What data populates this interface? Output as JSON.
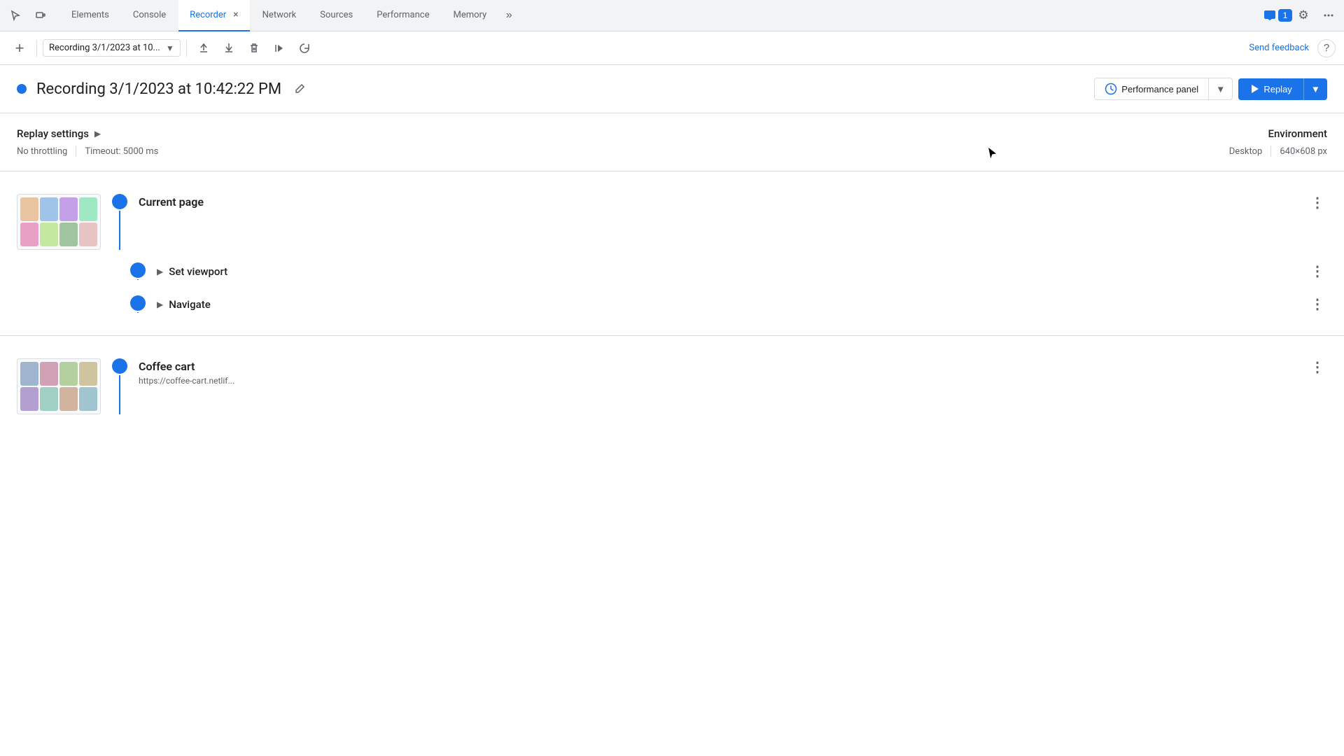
{
  "tabs": {
    "items": [
      {
        "label": "Elements",
        "active": false
      },
      {
        "label": "Console",
        "active": false
      },
      {
        "label": "Recorder",
        "active": true,
        "hasClose": true
      },
      {
        "label": "Network",
        "active": false
      },
      {
        "label": "Sources",
        "active": false
      },
      {
        "label": "Performance",
        "active": false
      },
      {
        "label": "Memory",
        "active": false
      }
    ],
    "more_label": "»",
    "badge": "1"
  },
  "toolbar": {
    "add_label": "+",
    "recording_name": "Recording 3/1/2023 at 10...",
    "send_feedback": "Send feedback",
    "help_icon": "?"
  },
  "recording": {
    "title": "Recording 3/1/2023 at 10:42:22 PM",
    "performance_panel_label": "Performance panel",
    "replay_label": "Replay"
  },
  "settings": {
    "title": "Replay settings",
    "throttling": "No throttling",
    "timeout": "Timeout: 5000 ms",
    "env_title": "Environment",
    "env_type": "Desktop",
    "env_resolution": "640×608 px"
  },
  "steps": [
    {
      "id": "step-1",
      "name": "Current page",
      "has_thumbnail": true,
      "sub_steps": []
    },
    {
      "id": "step-2",
      "name": "Set viewport",
      "has_thumbnail": false,
      "sub_steps": []
    },
    {
      "id": "step-3",
      "name": "Navigate",
      "has_thumbnail": false,
      "sub_steps": []
    },
    {
      "id": "step-4",
      "name": "Coffee cart",
      "url": "https://coffee-cart.netlif...",
      "has_thumbnail": true,
      "sub_steps": []
    }
  ],
  "thumbnail_colors": {
    "row1": [
      "#d4a",
      "#a8c",
      "#c4a",
      "#4a8"
    ],
    "row2": [
      "#8ac",
      "#ca4",
      "#a4c",
      "#c8a"
    ]
  },
  "icons": {
    "cursor_arrow": "↖",
    "inspect": "⬚",
    "device": "▣",
    "close": "×",
    "export": "↑",
    "import": "↓",
    "delete": "🗑",
    "replay_play": "▶",
    "step_replay": "↺",
    "more_tabs": "»",
    "gear": "⚙",
    "menu": "⋮",
    "edit": "✏",
    "chevron_right": "▶",
    "chevron_down": "▼"
  }
}
